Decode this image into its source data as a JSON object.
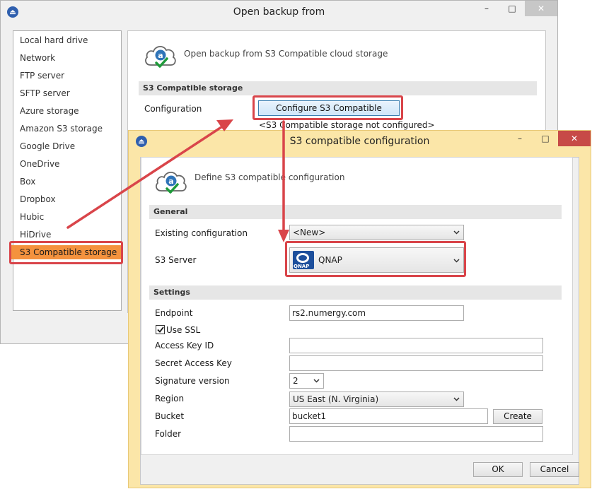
{
  "colors": {
    "accent": "#d9454a",
    "selected": "#f4923e",
    "dialog_border": "#fbe6a8"
  },
  "main_window": {
    "title": "Open backup from",
    "controls": {
      "minimize": "–",
      "maximize": "□",
      "close": "✕"
    },
    "sidebar": {
      "items": [
        {
          "label": "Local hard drive"
        },
        {
          "label": "Network"
        },
        {
          "label": "FTP server"
        },
        {
          "label": "SFTP server"
        },
        {
          "label": "Azure storage"
        },
        {
          "label": "Amazon S3 storage"
        },
        {
          "label": "Google Drive"
        },
        {
          "label": "OneDrive"
        },
        {
          "label": "Box"
        },
        {
          "label": "Dropbox"
        },
        {
          "label": "Hubic"
        },
        {
          "label": "HiDrive"
        },
        {
          "label": "S3 Compatible storage"
        }
      ],
      "selected_label": "S3 Compatible storage"
    },
    "header": {
      "icon": "cloud-check-icon",
      "text": "Open backup from S3 Compatible cloud storage"
    },
    "section_title": "S3 Compatible storage",
    "config_label": "Configuration",
    "configure_button": "Configure S3 Compatible",
    "status": "<S3 Compatible storage not configured>"
  },
  "dialog": {
    "title": "S3 compatible configuration",
    "controls": {
      "minimize": "–",
      "maximize": "□",
      "close": "✕"
    },
    "header_text": "Define S3 compatible configuration",
    "general_section": "General",
    "existing_config_label": "Existing configuration",
    "existing_config_value": "<New>",
    "s3_server_label": "S3 Server",
    "s3_server_value": "QNAP",
    "s3_server_logo": "QNAP",
    "settings_section": "Settings",
    "endpoint_label": "Endpoint",
    "endpoint_value": "rs2.numergy.com",
    "use_ssl_label": "Use SSL",
    "access_key_label": "Access Key ID",
    "access_key_value": "",
    "secret_key_label": "Secret Access Key",
    "secret_key_value": "",
    "signature_label": "Signature version",
    "signature_value": "2",
    "region_label": "Region",
    "region_value": "US East (N. Virginia)",
    "bucket_label": "Bucket",
    "bucket_value": "bucket1",
    "create_button": "Create",
    "folder_label": "Folder",
    "folder_value": "",
    "ok_button": "OK",
    "cancel_button": "Cancel"
  }
}
